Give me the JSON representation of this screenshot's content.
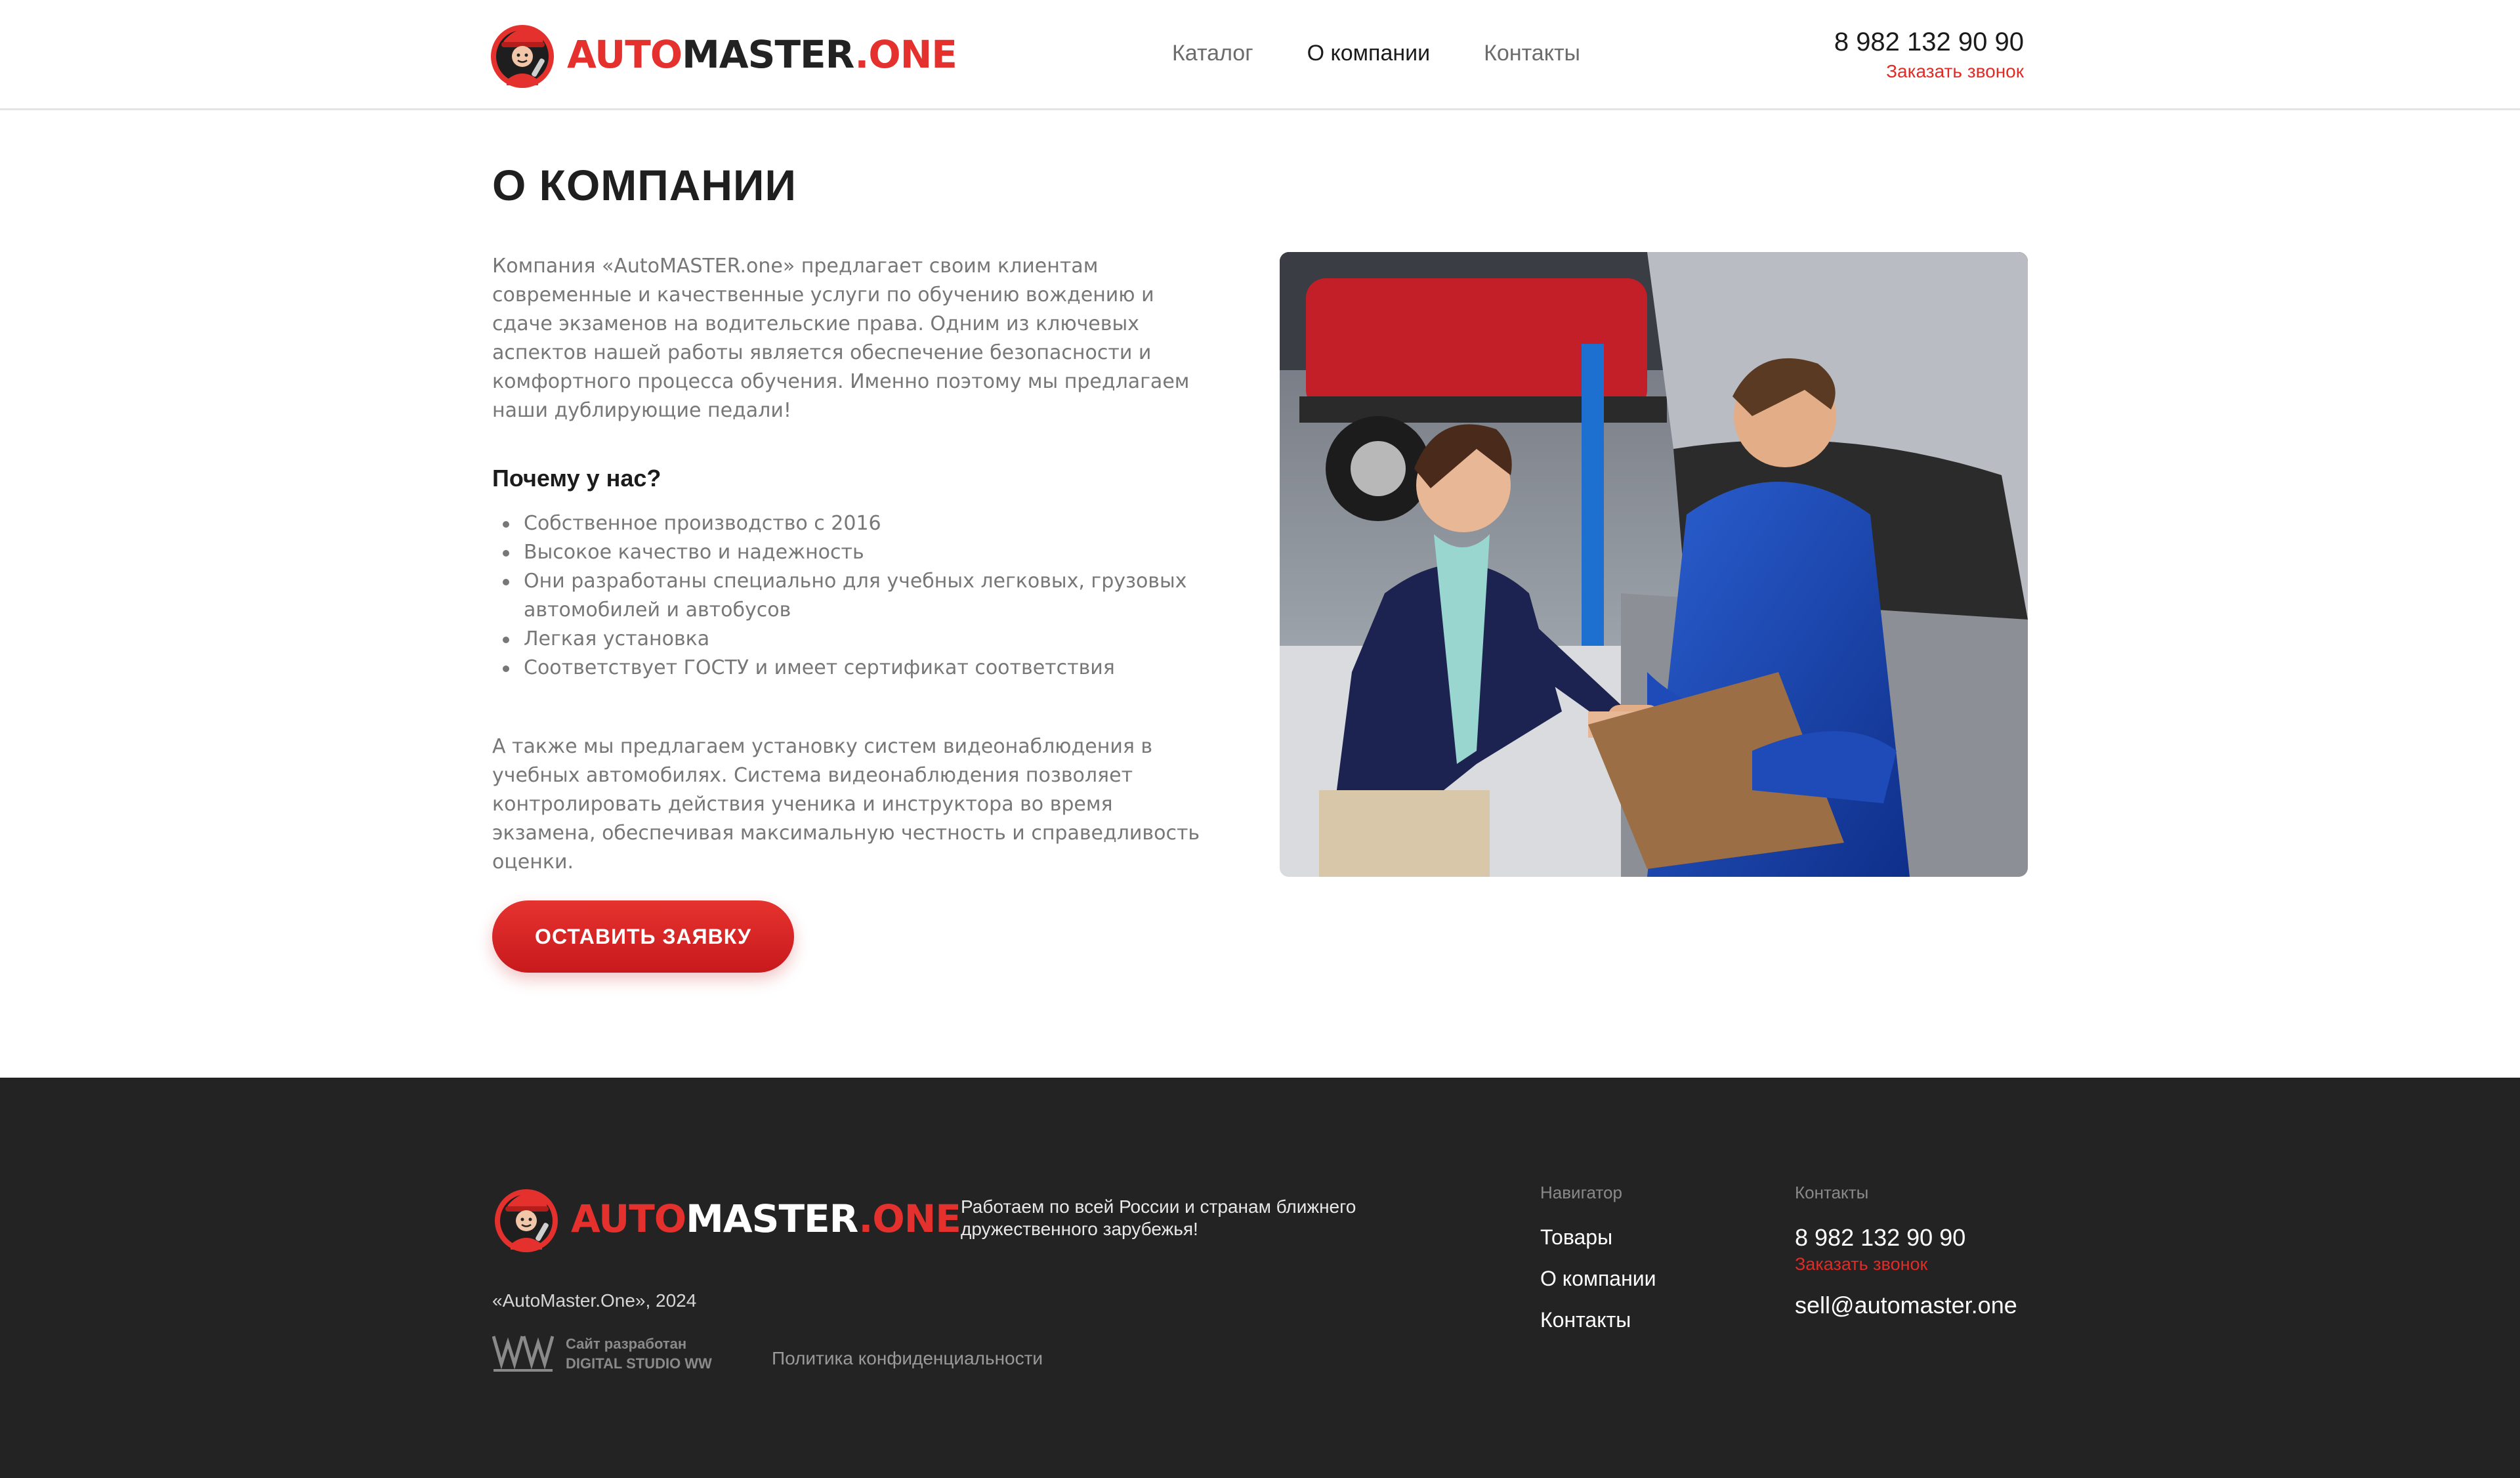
{
  "brand": {
    "name_red": "AUTO",
    "name_dark": "MASTER",
    "name_dot": ".ONE",
    "colors": {
      "accent": "#e5312d",
      "dark": "#222222",
      "footer_bg": "#232323"
    }
  },
  "header": {
    "nav": [
      {
        "label": "Каталог",
        "active": false
      },
      {
        "label": "О компании",
        "active": true
      },
      {
        "label": "Контакты",
        "active": false
      }
    ],
    "phone": "8 982 132 90 90",
    "callback": "Заказать звонок"
  },
  "main": {
    "title": "О КОМПАНИИ",
    "intro": "Компания «AutoMASTER.one» предлагает своим клиентам современные и качественные услуги по обучению вождению и сдаче экзаменов на водительские права. Одним из ключевых аспектов нашей работы является обеспечение безопасности и комфортного процесса обучения. Именно поэтому мы предлагаем наши дублирующие педали!",
    "why_title": "Почему у нас?",
    "why_items": [
      "Собственное производство с 2016",
      "Высокое качество и надежность",
      "Они разработаны специально для учебных легковых, грузовых автомобилей и автобусов",
      "Легкая установка",
      "Соответствует ГОСТУ и имеет сертификат  соответствия"
    ],
    "extra": "А также мы предлагаем установку систем видеонаблюдения в учебных автомобилях. Система видеонаблюдения позволяет контролировать действия ученика и инструктора во время экзамена, обеспечивая максимальную честность и справедливость оценки.",
    "cta": "ОСТАВИТЬ ЗАЯВКУ"
  },
  "footer": {
    "tagline": "Работаем по всей России и странам ближнего дружественного зарубежья!",
    "copyright": "«AutoMaster.One», 2024",
    "studio_line1": "Сайт разработан",
    "studio_line2": "DIGITAL STUDIO WW",
    "privacy": "Политика конфиденциальности",
    "nav_heading": "Навигатор",
    "nav_links": [
      "Товары",
      "О компании",
      "Контакты"
    ],
    "contacts_heading": "Контакты",
    "phone": "8 982 132 90 90",
    "callback": "Заказать звонок",
    "email": "sell@automaster.one"
  }
}
